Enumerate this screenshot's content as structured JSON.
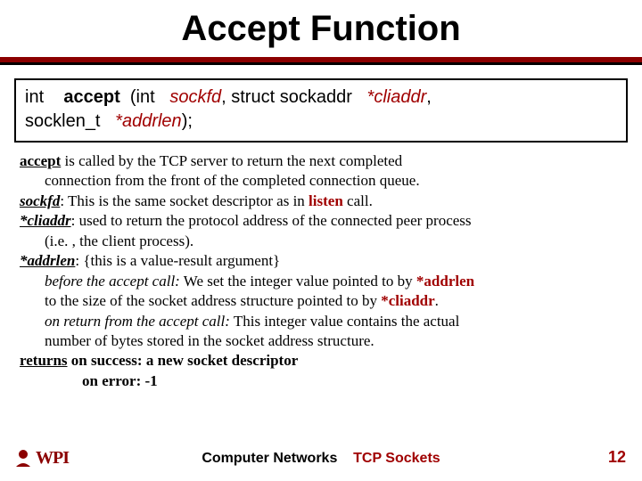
{
  "title": "Accept Function",
  "signature": {
    "ret": "int",
    "fn": "accept",
    "open": "(int",
    "arg1": "sockfd",
    "mid1": ", struct sockaddr",
    "arg2": "*cliaddr",
    "mid2": ",",
    "line2a": "socklen_t",
    "arg3": "*addrlen",
    "close": ");"
  },
  "body": {
    "l1a": "accept",
    "l1b": "  is called  by the TCP server to return the next completed",
    "l2": "connection from the front of the completed connection queue.",
    "l3a": "sockfd",
    "l3b": ":    This is the same socket descriptor as in ",
    "l3c": "listen",
    "l3d": " call.",
    "l4a": "*cliaddr",
    "l4b": ": used to return the protocol address of the connected peer process",
    "l5": "(i.e. , the client process).",
    "l6a": "*addrlen",
    "l6b": ": {this is a value-result argument}",
    "l7a": "before the accept call:",
    "l7b": " We set the integer value pointed to by ",
    "l7c": "*addrlen",
    "l8a": "to the size of the socket address structure pointed to by ",
    "l8b": "*cliaddr",
    "l8c": ".",
    "l9a": "on return from the accept call:",
    "l9b": " This integer value contains the actual",
    "l10": "number of bytes stored in the socket address structure.",
    "l11a": "returns",
    "l11b": "  on success: a new socket descriptor",
    "l12": "on error:    -1"
  },
  "footer": {
    "center1": "Computer Networks",
    "center2": "TCP Sockets",
    "page": "12",
    "logo_text": "WPI"
  }
}
